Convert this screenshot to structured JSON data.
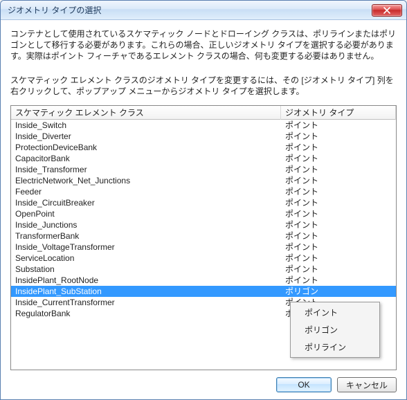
{
  "window": {
    "title": "ジオメトリ タイプの選択"
  },
  "description1": "コンテナとして使用されているスケマティック ノードとドローイング クラスは、ポリラインまたはポリゴンとして移行する必要があります。これらの場合、正しいジオメトリ タイプを選択する必要があります。実際はポイント フィーチャであるエレメント クラスの場合、何も変更する必要はありません。",
  "description2": "スケマティック エレメント クラスのジオメトリ タイプを変更するには、その [ジオメトリ タイプ] 列を右クリックして、ポップアップ メニューからジオメトリ タイプを選択します。",
  "grid": {
    "headers": {
      "name": "スケマティック エレメント クラス",
      "type": "ジオメトリ タイプ"
    },
    "rows": [
      {
        "name": "Inside_Switch",
        "type": "ポイント",
        "selected": false
      },
      {
        "name": "Inside_Diverter",
        "type": "ポイント",
        "selected": false
      },
      {
        "name": "ProtectionDeviceBank",
        "type": "ポイント",
        "selected": false
      },
      {
        "name": "CapacitorBank",
        "type": "ポイント",
        "selected": false
      },
      {
        "name": "Inside_Transformer",
        "type": "ポイント",
        "selected": false
      },
      {
        "name": "ElectricNetwork_Net_Junctions",
        "type": "ポイント",
        "selected": false
      },
      {
        "name": "Feeder",
        "type": "ポイント",
        "selected": false
      },
      {
        "name": "Inside_CircuitBreaker",
        "type": "ポイント",
        "selected": false
      },
      {
        "name": "OpenPoint",
        "type": "ポイント",
        "selected": false
      },
      {
        "name": "Inside_Junctions",
        "type": "ポイント",
        "selected": false
      },
      {
        "name": "TransformerBank",
        "type": "ポイント",
        "selected": false
      },
      {
        "name": "Inside_VoltageTransformer",
        "type": "ポイント",
        "selected": false
      },
      {
        "name": "ServiceLocation",
        "type": "ポイント",
        "selected": false
      },
      {
        "name": "Substation",
        "type": "ポイント",
        "selected": false
      },
      {
        "name": "InsidePlant_RootNode",
        "type": "ポイント",
        "selected": false
      },
      {
        "name": "InsidePlant_SubStation",
        "type": "ポリゴン",
        "selected": true
      },
      {
        "name": "Inside_CurrentTransformer",
        "type": "ポイント",
        "selected": false
      },
      {
        "name": "RegulatorBank",
        "type": "ポイント",
        "selected": false
      }
    ]
  },
  "context_menu": {
    "items": [
      "ポイント",
      "ポリゴン",
      "ポリライン"
    ]
  },
  "buttons": {
    "ok": "OK",
    "cancel": "キャンセル"
  }
}
